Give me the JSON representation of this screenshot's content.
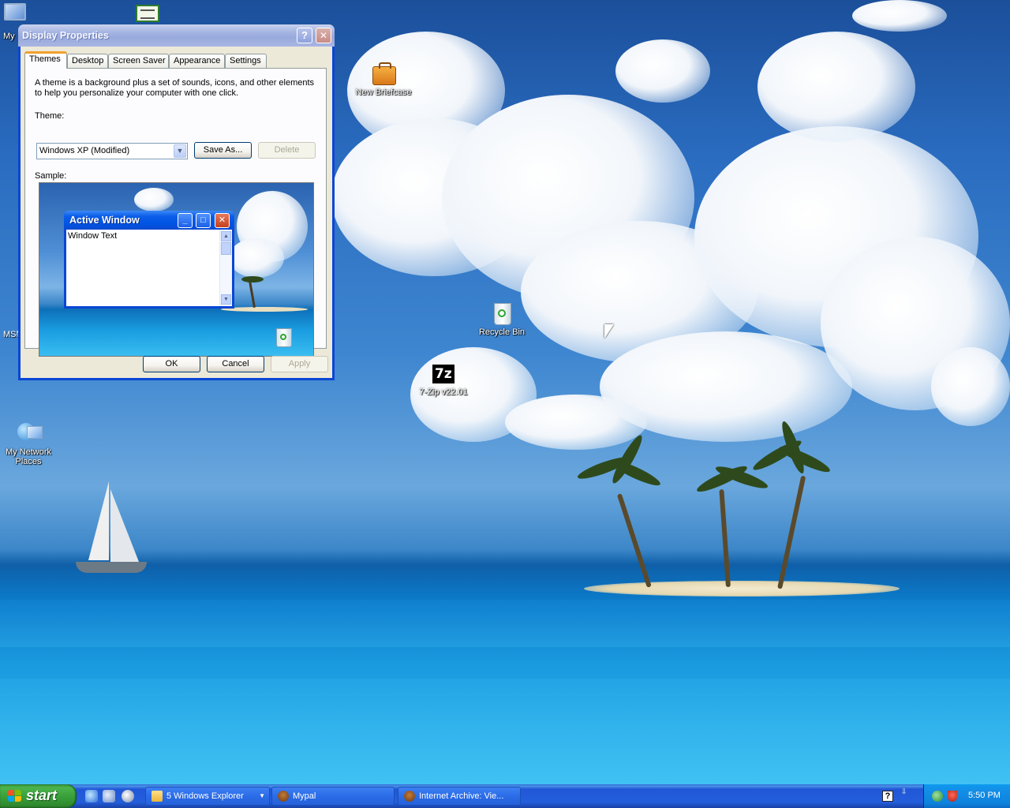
{
  "desktop": {
    "icons": [
      {
        "id": "my-computer",
        "label": "My"
      },
      {
        "id": "msn",
        "label": "MSN"
      },
      {
        "id": "new-briefcase",
        "label": "New Briefcase"
      },
      {
        "id": "recycle-bin",
        "label": "Recycle Bin"
      },
      {
        "id": "seven-zip",
        "label": "7-Zip v22.01"
      },
      {
        "id": "my-network-places",
        "label": "My Network Places"
      }
    ]
  },
  "dialog": {
    "title": "Display Properties",
    "help_button": "?",
    "close_button": "✕",
    "tabs": [
      "Themes",
      "Desktop",
      "Screen Saver",
      "Appearance",
      "Settings"
    ],
    "active_tab": "Themes",
    "description": "A theme is a background plus a set of sounds, icons, and other elements to help you personalize your computer with one click.",
    "theme_label": "Theme:",
    "theme_value": "Windows XP (Modified)",
    "save_as_button": "Save As...",
    "delete_button": "Delete",
    "sample_label": "Sample:",
    "preview": {
      "window_title": "Active Window",
      "window_text": "Window Text"
    },
    "ok_button": "OK",
    "cancel_button": "Cancel",
    "apply_button": "Apply"
  },
  "taskbar": {
    "start_label": "start",
    "items": [
      {
        "label": "5 Windows Explorer"
      },
      {
        "label": "Mypal"
      },
      {
        "label": "Internet Archive: Vie..."
      }
    ],
    "clock": "5:50 PM"
  },
  "colors": {
    "xp_blue": "#0054e3",
    "start_green": "#3aa13a",
    "tray_blue": "#0e82dd"
  }
}
